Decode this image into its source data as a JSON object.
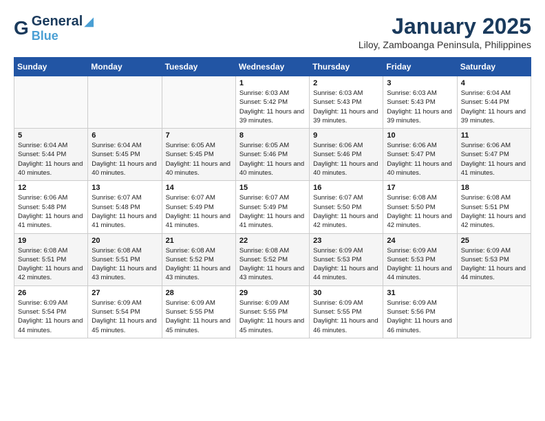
{
  "header": {
    "logo": {
      "general": "General",
      "blue": "Blue"
    },
    "title": "January 2025",
    "location": "Liloy, Zamboanga Peninsula, Philippines"
  },
  "weekdays": [
    "Sunday",
    "Monday",
    "Tuesday",
    "Wednesday",
    "Thursday",
    "Friday",
    "Saturday"
  ],
  "weeks": [
    [
      {
        "day": "",
        "sunrise": "",
        "sunset": "",
        "daylight": ""
      },
      {
        "day": "",
        "sunrise": "",
        "sunset": "",
        "daylight": ""
      },
      {
        "day": "",
        "sunrise": "",
        "sunset": "",
        "daylight": ""
      },
      {
        "day": "1",
        "sunrise": "Sunrise: 6:03 AM",
        "sunset": "Sunset: 5:42 PM",
        "daylight": "Daylight: 11 hours and 39 minutes."
      },
      {
        "day": "2",
        "sunrise": "Sunrise: 6:03 AM",
        "sunset": "Sunset: 5:43 PM",
        "daylight": "Daylight: 11 hours and 39 minutes."
      },
      {
        "day": "3",
        "sunrise": "Sunrise: 6:03 AM",
        "sunset": "Sunset: 5:43 PM",
        "daylight": "Daylight: 11 hours and 39 minutes."
      },
      {
        "day": "4",
        "sunrise": "Sunrise: 6:04 AM",
        "sunset": "Sunset: 5:44 PM",
        "daylight": "Daylight: 11 hours and 39 minutes."
      }
    ],
    [
      {
        "day": "5",
        "sunrise": "Sunrise: 6:04 AM",
        "sunset": "Sunset: 5:44 PM",
        "daylight": "Daylight: 11 hours and 40 minutes."
      },
      {
        "day": "6",
        "sunrise": "Sunrise: 6:04 AM",
        "sunset": "Sunset: 5:45 PM",
        "daylight": "Daylight: 11 hours and 40 minutes."
      },
      {
        "day": "7",
        "sunrise": "Sunrise: 6:05 AM",
        "sunset": "Sunset: 5:45 PM",
        "daylight": "Daylight: 11 hours and 40 minutes."
      },
      {
        "day": "8",
        "sunrise": "Sunrise: 6:05 AM",
        "sunset": "Sunset: 5:46 PM",
        "daylight": "Daylight: 11 hours and 40 minutes."
      },
      {
        "day": "9",
        "sunrise": "Sunrise: 6:06 AM",
        "sunset": "Sunset: 5:46 PM",
        "daylight": "Daylight: 11 hours and 40 minutes."
      },
      {
        "day": "10",
        "sunrise": "Sunrise: 6:06 AM",
        "sunset": "Sunset: 5:47 PM",
        "daylight": "Daylight: 11 hours and 40 minutes."
      },
      {
        "day": "11",
        "sunrise": "Sunrise: 6:06 AM",
        "sunset": "Sunset: 5:47 PM",
        "daylight": "Daylight: 11 hours and 41 minutes."
      }
    ],
    [
      {
        "day": "12",
        "sunrise": "Sunrise: 6:06 AM",
        "sunset": "Sunset: 5:48 PM",
        "daylight": "Daylight: 11 hours and 41 minutes."
      },
      {
        "day": "13",
        "sunrise": "Sunrise: 6:07 AM",
        "sunset": "Sunset: 5:48 PM",
        "daylight": "Daylight: 11 hours and 41 minutes."
      },
      {
        "day": "14",
        "sunrise": "Sunrise: 6:07 AM",
        "sunset": "Sunset: 5:49 PM",
        "daylight": "Daylight: 11 hours and 41 minutes."
      },
      {
        "day": "15",
        "sunrise": "Sunrise: 6:07 AM",
        "sunset": "Sunset: 5:49 PM",
        "daylight": "Daylight: 11 hours and 41 minutes."
      },
      {
        "day": "16",
        "sunrise": "Sunrise: 6:07 AM",
        "sunset": "Sunset: 5:50 PM",
        "daylight": "Daylight: 11 hours and 42 minutes."
      },
      {
        "day": "17",
        "sunrise": "Sunrise: 6:08 AM",
        "sunset": "Sunset: 5:50 PM",
        "daylight": "Daylight: 11 hours and 42 minutes."
      },
      {
        "day": "18",
        "sunrise": "Sunrise: 6:08 AM",
        "sunset": "Sunset: 5:51 PM",
        "daylight": "Daylight: 11 hours and 42 minutes."
      }
    ],
    [
      {
        "day": "19",
        "sunrise": "Sunrise: 6:08 AM",
        "sunset": "Sunset: 5:51 PM",
        "daylight": "Daylight: 11 hours and 42 minutes."
      },
      {
        "day": "20",
        "sunrise": "Sunrise: 6:08 AM",
        "sunset": "Sunset: 5:51 PM",
        "daylight": "Daylight: 11 hours and 43 minutes."
      },
      {
        "day": "21",
        "sunrise": "Sunrise: 6:08 AM",
        "sunset": "Sunset: 5:52 PM",
        "daylight": "Daylight: 11 hours and 43 minutes."
      },
      {
        "day": "22",
        "sunrise": "Sunrise: 6:08 AM",
        "sunset": "Sunset: 5:52 PM",
        "daylight": "Daylight: 11 hours and 43 minutes."
      },
      {
        "day": "23",
        "sunrise": "Sunrise: 6:09 AM",
        "sunset": "Sunset: 5:53 PM",
        "daylight": "Daylight: 11 hours and 44 minutes."
      },
      {
        "day": "24",
        "sunrise": "Sunrise: 6:09 AM",
        "sunset": "Sunset: 5:53 PM",
        "daylight": "Daylight: 11 hours and 44 minutes."
      },
      {
        "day": "25",
        "sunrise": "Sunrise: 6:09 AM",
        "sunset": "Sunset: 5:53 PM",
        "daylight": "Daylight: 11 hours and 44 minutes."
      }
    ],
    [
      {
        "day": "26",
        "sunrise": "Sunrise: 6:09 AM",
        "sunset": "Sunset: 5:54 PM",
        "daylight": "Daylight: 11 hours and 44 minutes."
      },
      {
        "day": "27",
        "sunrise": "Sunrise: 6:09 AM",
        "sunset": "Sunset: 5:54 PM",
        "daylight": "Daylight: 11 hours and 45 minutes."
      },
      {
        "day": "28",
        "sunrise": "Sunrise: 6:09 AM",
        "sunset": "Sunset: 5:55 PM",
        "daylight": "Daylight: 11 hours and 45 minutes."
      },
      {
        "day": "29",
        "sunrise": "Sunrise: 6:09 AM",
        "sunset": "Sunset: 5:55 PM",
        "daylight": "Daylight: 11 hours and 45 minutes."
      },
      {
        "day": "30",
        "sunrise": "Sunrise: 6:09 AM",
        "sunset": "Sunset: 5:55 PM",
        "daylight": "Daylight: 11 hours and 46 minutes."
      },
      {
        "day": "31",
        "sunrise": "Sunrise: 6:09 AM",
        "sunset": "Sunset: 5:56 PM",
        "daylight": "Daylight: 11 hours and 46 minutes."
      },
      {
        "day": "",
        "sunrise": "",
        "sunset": "",
        "daylight": ""
      }
    ]
  ]
}
